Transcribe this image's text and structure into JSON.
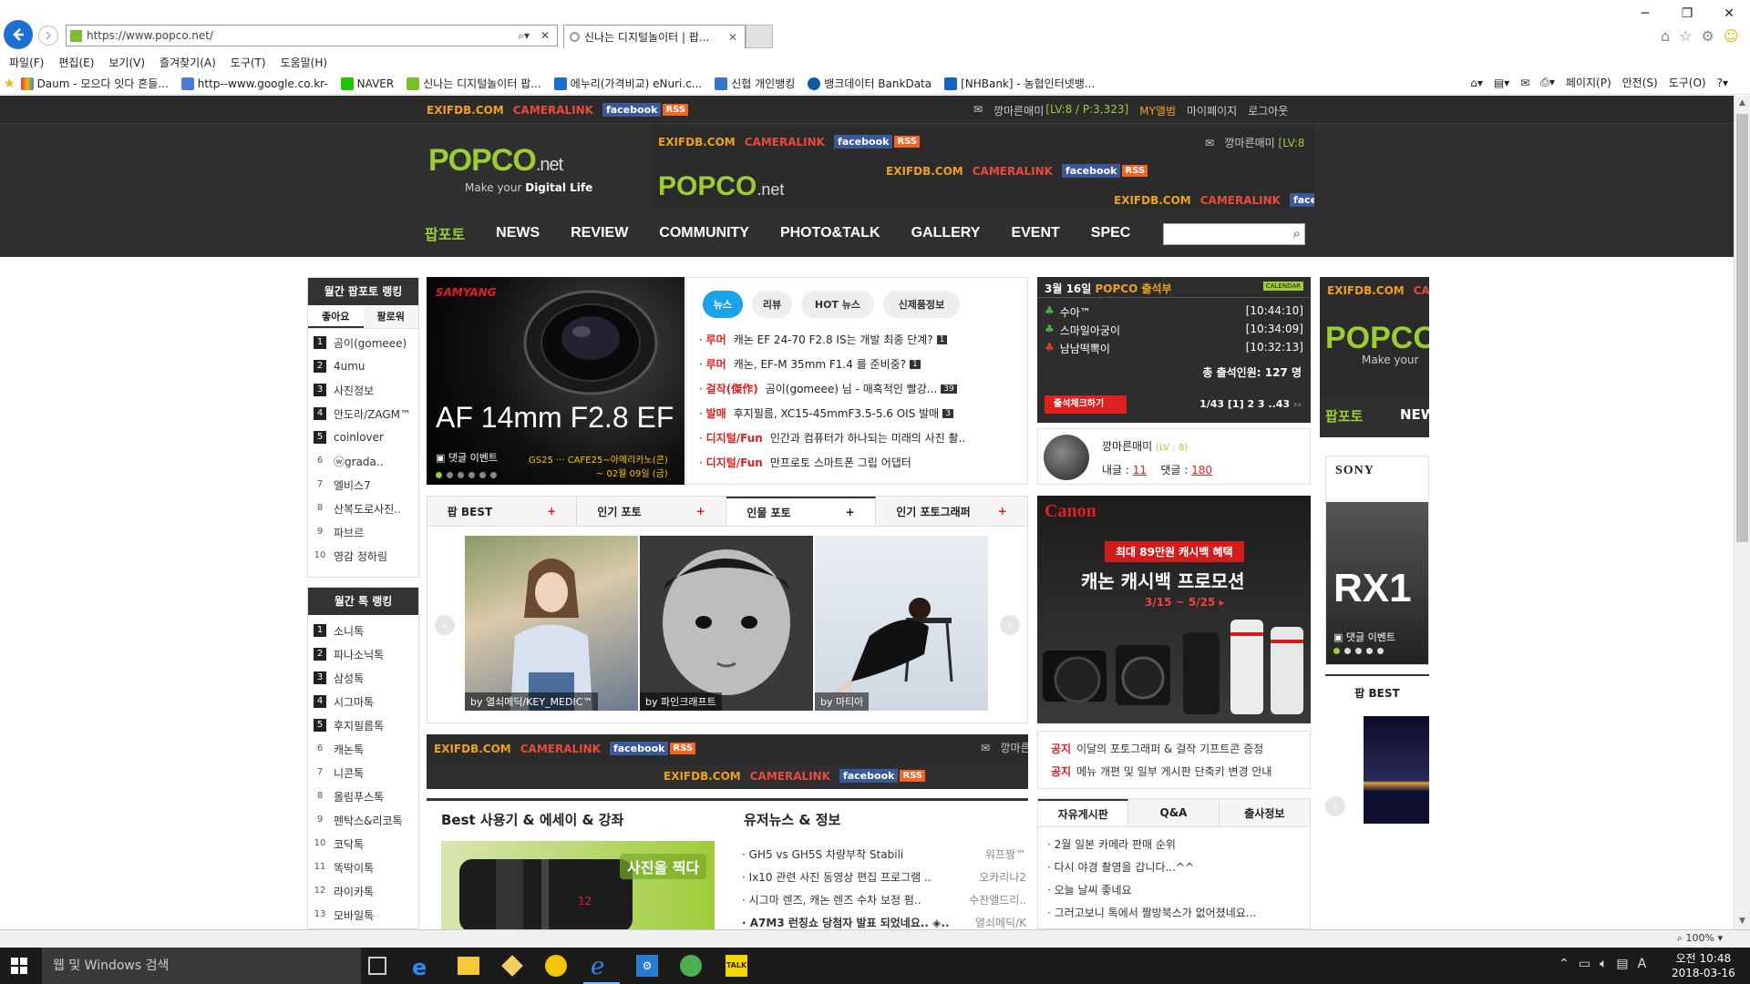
{
  "browser": {
    "url": "https://www.popco.net/",
    "tab_title": "신나는 디지털놀이터 | 팝...",
    "menu": [
      "파일(F)",
      "편집(E)",
      "보기(V)",
      "즐겨찾기(A)",
      "도구(T)",
      "도움말(H)"
    ],
    "favorites": [
      "Daum - 모으다 잇다 흔들...",
      "http--www.google.co.kr-",
      "NAVER",
      "신나는 디지털놀이터 팝...",
      "에누리(가격비교) eNuri.c...",
      "신협 개인뱅킹",
      "뱅크데이터 BankData",
      "[NHBank] - 농협인터넷뱅..."
    ],
    "commands": [
      "페이지(P)",
      "안전(S)",
      "도구(O)"
    ],
    "zoom": "100%"
  },
  "site": {
    "brands": {
      "exif": "EXIFDB.COM",
      "camera": "CAMERALINK",
      "facebook": "facebook",
      "rss": "RSS"
    },
    "user_strip": {
      "name": "깡마른매미",
      "level": "[LV:8 / P:3,323]",
      "myalbum": "MY앨범",
      "mypage": "마이페이지",
      "logout": "로그아웃"
    },
    "header_user_short": "깡마른매미",
    "header_user_lv": "[LV:8",
    "logo": {
      "popco": "POPCO",
      "net": ".net",
      "tagline_1": "Make your ",
      "tagline_2": "Digital Life"
    },
    "nav": [
      "팝포토",
      "NEWS",
      "REVIEW",
      "COMMUNITY",
      "PHOTO&TALK",
      "GALLERY",
      "EVENT",
      "SPEC"
    ]
  },
  "left": {
    "monthly_title": "월간 팝포토 랭킹",
    "tabs": [
      "좋아요",
      "팔로워"
    ],
    "ranking": [
      "곰이(gomeee)",
      "4umu",
      "사진정보",
      "안도라/ZAGM™",
      "coinlover",
      "ⓦgrada..",
      "엘비스7",
      "산복도로사진..",
      "파브르",
      "영감 정하림"
    ],
    "talk_title": "월간 톡 랭킹",
    "talk_ranking": [
      "소니톡",
      "파나소닉톡",
      "삼성톡",
      "시그마톡",
      "후지필름톡",
      "캐논톡",
      "니콘톡",
      "올림푸스톡",
      "펜탁스&리코톡",
      "코닥톡",
      "똑딱이톡",
      "라이카톡",
      "모바일톡"
    ]
  },
  "banner": {
    "brand": "SAMYANG",
    "headline": "AF 14mm F2.8 EF",
    "event": "댓글 이벤트",
    "event_desc": "GS25 ··· CAFE25~아메리카노(콘)",
    "event_date": "~ 02월 09일 (금)"
  },
  "news": {
    "pills": [
      "뉴스",
      "리뷰",
      "HOT 뉴스",
      "신제품정보"
    ],
    "items": [
      {
        "cat": "루머",
        "title": "캐논 EF 24-70 F2.8 IS는 개발 최종 단계?",
        "count": "1"
      },
      {
        "cat": "루머",
        "title": "캐논, EF-M 35mm F1.4 를 준비중?",
        "count": "1"
      },
      {
        "cat": "걸작(傑作)",
        "title": "곰이(gomeee) 님 - 매혹적인 빨강...",
        "count": "39"
      },
      {
        "cat": "발매",
        "title": "후지필름, XC15-45mmF3.5-5.6 OIS 발매",
        "count": "3"
      },
      {
        "cat": "디지털/Fun",
        "title": "인간과 컴퓨터가 하나되는 미래의 사진 촬..",
        "count": ""
      },
      {
        "cat": "디지털/Fun",
        "title": "만프로토 스마트폰 그립 어댑터",
        "count": ""
      }
    ]
  },
  "photo_tabs": [
    "팝 BEST",
    "인기 포토",
    "인물 포토",
    "인기 포토그래퍼"
  ],
  "photo_tab_plus": "+",
  "photos": [
    {
      "by": "by 열쇠메딕/KEY_MEDIC™"
    },
    {
      "by": "by 파인크래프트"
    },
    {
      "by": "by 마티아"
    }
  ],
  "attendance": {
    "date": "3월 16일",
    "title": "POPCO 출석부",
    "badge": "CALENDAR",
    "entries": [
      {
        "name": "수아™",
        "time": "[10:44:10]"
      },
      {
        "name": "스마일아궁이",
        "time": "[10:34:09]"
      },
      {
        "name": "남남떡뽁이",
        "time": "[10:32:13]"
      }
    ],
    "total": "총 출석인원: 127 명",
    "button": "출석체크하기",
    "pager": "1/43 [1] 2  3 ..43"
  },
  "profile": {
    "name": "깡마른매미",
    "level": "(LV : 8)",
    "posts_label": "내글 :",
    "posts": "11",
    "comments_label": "댓글 :",
    "comments": "180"
  },
  "canon_ad": {
    "brand": "Canon",
    "line1": "최대 89만원 캐시백 혜택",
    "line2": "캐논 캐시백 프로모션",
    "line3": "3/15 ~ 5/25 ▸"
  },
  "notices": [
    {
      "tag": "공지",
      "text": "이달의 포토그래퍼 & 걸작 기프트콘 증정"
    },
    {
      "tag": "공지",
      "text": "메뉴 개편 및 일부 게시판 단축키 변경 안내"
    }
  ],
  "board_tabs": [
    "자유게시판",
    "Q&A",
    "출사정보"
  ],
  "board_items": [
    "2월 일본 카메라 판매 순위",
    "다시 야경 촬영을 갑니다...^^",
    "오늘 날씨 좋네요",
    "그러고보니 톡에서 짤방북스가 없어졌네요..."
  ],
  "best_section": {
    "title": "Best 사용기 & 에세이 & 강좌",
    "image_text": "사진을 찍다"
  },
  "user_news": {
    "title": "유저뉴스 & 정보",
    "items": [
      {
        "t": "GH5 vs GH5S 차량부착 Stabili",
        "a": "워프짱™"
      },
      {
        "t": "Ix10 관련 사진 동영상 편집 프로그램 ..",
        "a": "오카리나2"
      },
      {
        "t": "시그마 렌즈, 캐논 렌즈 수차 보정 펌..",
        "a": "수잔엘드리.."
      },
      {
        "t": "A7M3 런칭쇼 당첨자 발표 되었네요.. ◈..",
        "a": "열쇠메딕/K"
      }
    ]
  },
  "right_col": {
    "sony": "SONY",
    "rx": "RX1",
    "event": "댓글 이벤트",
    "best": "팝 BEST",
    "nav_short": "팝포토",
    "nav_new": "NEW"
  },
  "taskbar": {
    "search": "웹 및 Windows 검색",
    "time": "오전 10:48",
    "date": "2018-03-16",
    "ime": "A"
  }
}
